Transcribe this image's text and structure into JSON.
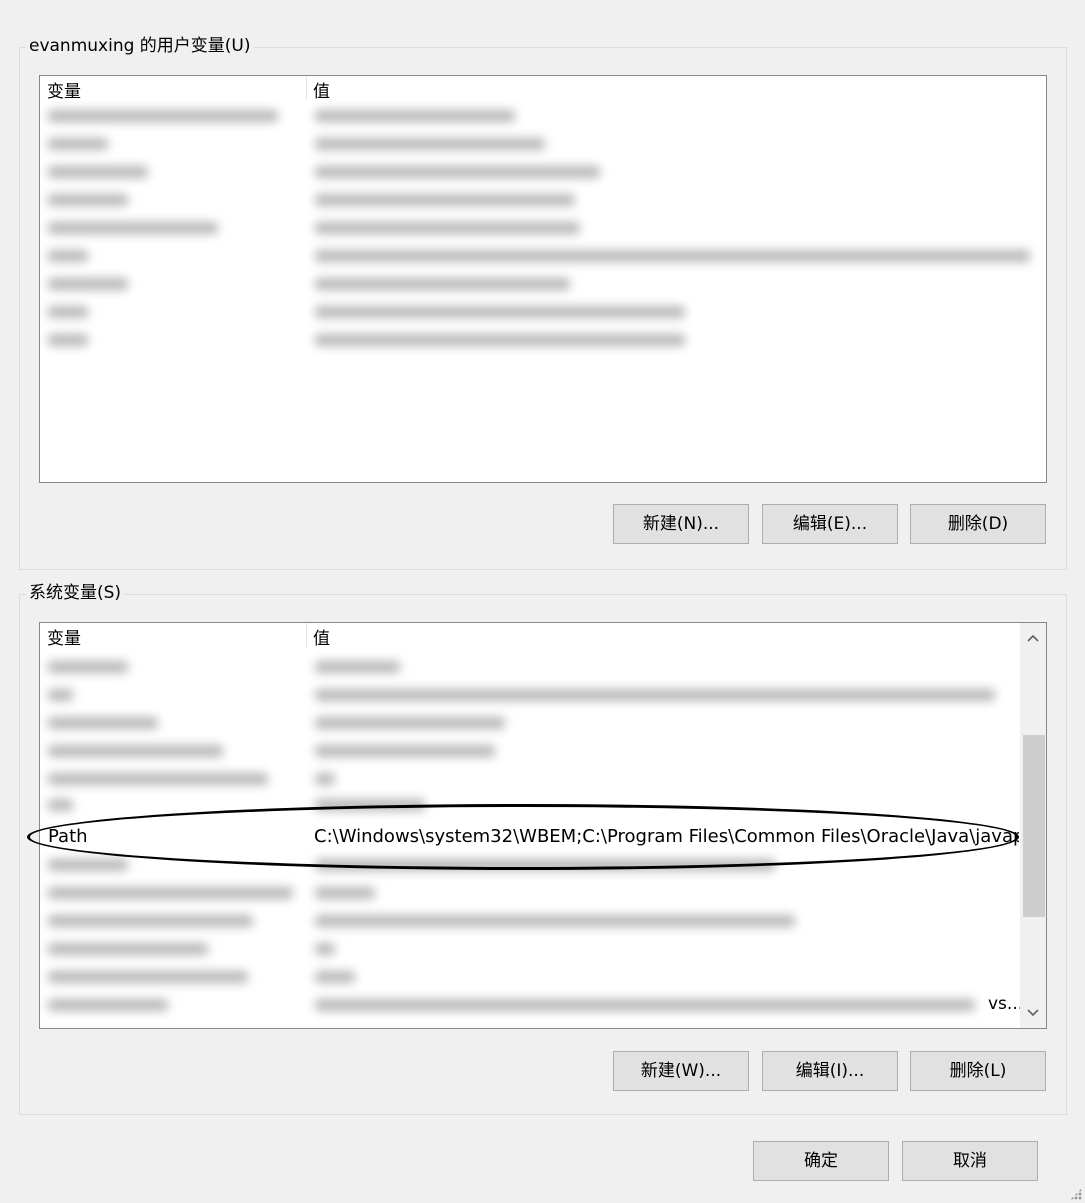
{
  "user_vars": {
    "title": "evanmuxing 的用户变量(U)",
    "columns": {
      "variable": "变量",
      "value": "值"
    },
    "buttons": {
      "new": "新建(N)...",
      "edit": "编辑(E)...",
      "delete": "删除(D)"
    }
  },
  "system_vars": {
    "title": "系统变量(S)",
    "columns": {
      "variable": "变量",
      "value": "值"
    },
    "highlighted_row": {
      "name": "Path",
      "value": "C:\\Windows\\system32\\WBEM;C:\\Program Files\\Common Files\\Oracle\\Java\\javap..."
    },
    "truncated_tail": "vs...",
    "buttons": {
      "new": "新建(W)...",
      "edit": "编辑(I)...",
      "delete": "删除(L)"
    }
  },
  "dialog_buttons": {
    "ok": "确定",
    "cancel": "取消"
  },
  "icons": {
    "scroll_up": "chevron-up-icon",
    "scroll_down": "chevron-down-icon",
    "resize_grip": "resize-grip-icon"
  }
}
